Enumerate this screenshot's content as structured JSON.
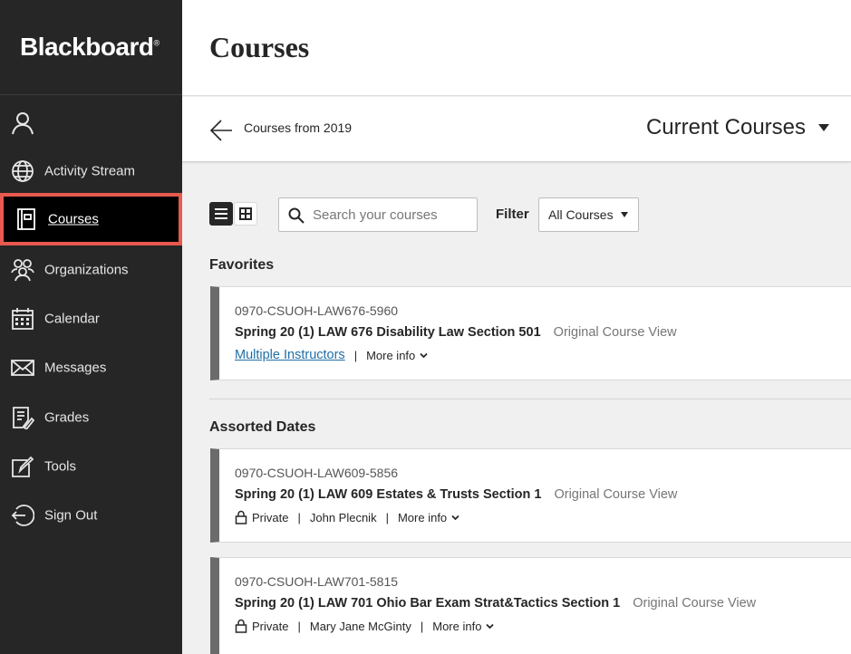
{
  "app": {
    "logo": "Blackboard",
    "logo_mark": "®"
  },
  "sidebar": {
    "items": [
      {
        "label": "",
        "icon": "user-icon"
      },
      {
        "label": "Activity Stream",
        "icon": "globe-icon"
      },
      {
        "label": "Courses",
        "icon": "courses-icon",
        "active": true
      },
      {
        "label": "Organizations",
        "icon": "organizations-icon"
      },
      {
        "label": "Calendar",
        "icon": "calendar-icon"
      },
      {
        "label": "Messages",
        "icon": "envelope-icon"
      },
      {
        "label": "Grades",
        "icon": "grades-icon"
      },
      {
        "label": "Tools",
        "icon": "tools-icon"
      },
      {
        "label": "Sign Out",
        "icon": "sign-out-icon"
      }
    ]
  },
  "header": {
    "title": "Courses"
  },
  "subheader": {
    "back_label": "Courses from 2019",
    "term_select": "Current Courses"
  },
  "toolbar": {
    "search_placeholder": "Search your courses",
    "filter_label": "Filter",
    "filter_value": "All Courses"
  },
  "sections": {
    "favorites": {
      "title": "Favorites",
      "courses": [
        {
          "id": "0970-CSUOH-LAW676-5960",
          "name": "Spring 20 (1) LAW 676 Disability Law Section 501",
          "view": "Original Course View",
          "instructor": "Multiple Instructors",
          "more_info": "More info"
        }
      ]
    },
    "assorted": {
      "title": "Assorted Dates",
      "courses": [
        {
          "id": "0970-CSUOH-LAW609-5856",
          "name": "Spring 20 (1) LAW 609 Estates & Trusts Section 1",
          "view": "Original Course View",
          "privacy": "Private",
          "instructor": "John Plecnik",
          "more_info": "More info"
        },
        {
          "id": "0970-CSUOH-LAW701-5815",
          "name": "Spring 20 (1) LAW 701 Ohio Bar Exam Strat&Tactics Section 1",
          "view": "Original Course View",
          "privacy": "Private",
          "instructor": "Mary Jane McGinty",
          "more_info": "More info"
        }
      ]
    }
  },
  "colors": {
    "sidebar_bg": "#262626",
    "active_outline": "#e8594f",
    "link": "#1f6fa6",
    "card_accent": "#6b6b6b"
  }
}
